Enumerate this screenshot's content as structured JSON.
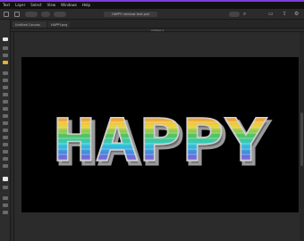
{
  "menu": [
    "Text",
    "Layer",
    "Select",
    "View",
    "Windows",
    "Help"
  ],
  "toolbar": {
    "document_title": "HAPPY rainbow text.psd"
  },
  "tabs": [
    {
      "label": "Untitled Canvas"
    },
    {
      "label": "HAPPY.png"
    }
  ],
  "ruler": {
    "label": "Untitled-1"
  },
  "canvas_text": "HAPPY",
  "colors": {
    "accent": "#7a3fd6",
    "canvas_background": "#000000",
    "rainbow": [
      "#d9373b",
      "#f08a2a",
      "#f1d23a",
      "#52c45a",
      "#2fc9d9",
      "#4a7de0",
      "#c448c9",
      "#e85d9b"
    ]
  }
}
